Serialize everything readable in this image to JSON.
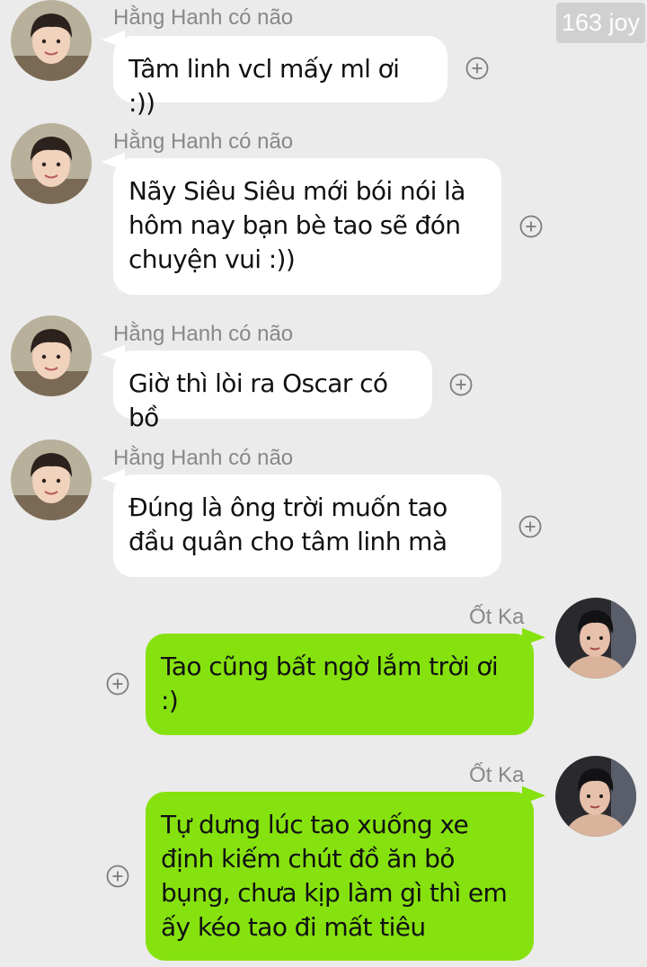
{
  "watermark": "163 joy",
  "messages": [
    {
      "sender": "Hằng Hanh có não",
      "text": "Tâm linh vcl mấy ml ơi :))",
      "direction": "incoming",
      "icons": {
        "avatar": "avatar-boy-icon",
        "action": "plus-circle-icon"
      }
    },
    {
      "sender": "Hằng Hanh có não",
      "text": "Nãy Siêu Siêu mới bói nói là hôm nay bạn bè tao sẽ đón chuyện vui :))",
      "direction": "incoming",
      "icons": {
        "avatar": "avatar-boy-icon",
        "action": "plus-circle-icon"
      }
    },
    {
      "sender": "Hằng Hanh có não",
      "text": "Giờ thì lòi ra Oscar có bồ",
      "direction": "incoming",
      "icons": {
        "avatar": "avatar-boy-icon",
        "action": "plus-circle-icon"
      }
    },
    {
      "sender": "Hằng Hanh có não",
      "text": "Đúng là ông trời muốn tao đầu quân cho tâm linh mà",
      "direction": "incoming",
      "icons": {
        "avatar": "avatar-boy-icon",
        "action": "plus-circle-icon"
      }
    },
    {
      "sender": "Ốt Ka",
      "text": "Tao cũng bất ngờ lắm trời ơi :)",
      "direction": "outgoing",
      "icons": {
        "avatar": "avatar-man-icon",
        "action": "plus-circle-icon"
      }
    },
    {
      "sender": "Ốt Ka",
      "text": "Tự dưng lúc tao xuống xe định kiếm chút đồ ăn bỏ bụng, chưa kịp làm gì thì em ấy kéo tao đi mất tiêu",
      "direction": "outgoing",
      "icons": {
        "avatar": "avatar-man-icon",
        "action": "plus-circle-icon"
      }
    }
  ],
  "colors": {
    "background": "#ebebeb",
    "incoming_bubble": "#ffffff",
    "outgoing_bubble": "#86e20e",
    "sender_name": "#888888",
    "watermark_bg": "#d0d0d0"
  }
}
